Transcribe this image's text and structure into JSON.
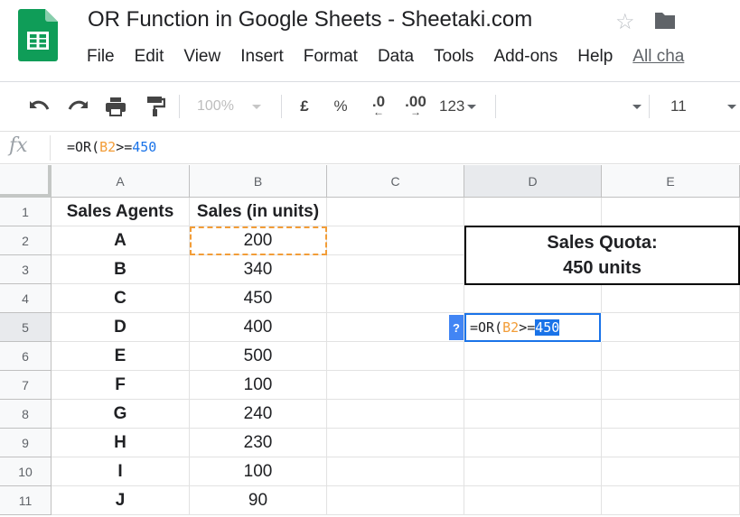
{
  "document": {
    "title": "OR Function in Google Sheets - Sheetaki.com"
  },
  "menu": {
    "items": [
      "File",
      "Edit",
      "View",
      "Insert",
      "Format",
      "Data",
      "Tools",
      "Add-ons",
      "Help"
    ],
    "all_changes": "All cha"
  },
  "toolbar": {
    "zoom": "100%",
    "currency": "£",
    "percent": "%",
    "decrease_decimal": ".0",
    "increase_decimal": ".00",
    "more_formats": "123",
    "font_size": "11"
  },
  "formula_bar": {
    "fx": "fx",
    "formula_prefix": "=OR(",
    "formula_ref": "B2",
    "formula_op": ">=",
    "formula_num": "450"
  },
  "columns": [
    "A",
    "B",
    "C",
    "D",
    "E"
  ],
  "rows": [
    "1",
    "2",
    "3",
    "4",
    "5",
    "6",
    "7",
    "8",
    "9",
    "10",
    "11"
  ],
  "table": {
    "header_a": "Sales Agents",
    "header_b": "Sales (in units)",
    "data": [
      {
        "agent": "A",
        "sales": "200"
      },
      {
        "agent": "B",
        "sales": "340"
      },
      {
        "agent": "C",
        "sales": "450"
      },
      {
        "agent": "D",
        "sales": "400"
      },
      {
        "agent": "E",
        "sales": "500"
      },
      {
        "agent": "F",
        "sales": "100"
      },
      {
        "agent": "G",
        "sales": "240"
      },
      {
        "agent": "H",
        "sales": "230"
      },
      {
        "agent": "I",
        "sales": "100"
      },
      {
        "agent": "J",
        "sales": "90"
      }
    ]
  },
  "quota": {
    "line1": "Sales Quota:",
    "line2": "450 units"
  },
  "edit_cell": {
    "help": "?",
    "prefix": "=OR(",
    "ref": "B2",
    "op": ">=",
    "num": "450"
  },
  "colors": {
    "sheets_green": "#0f9d58",
    "selection_blue": "#1a73e8",
    "reference_orange": "#f29d38"
  }
}
